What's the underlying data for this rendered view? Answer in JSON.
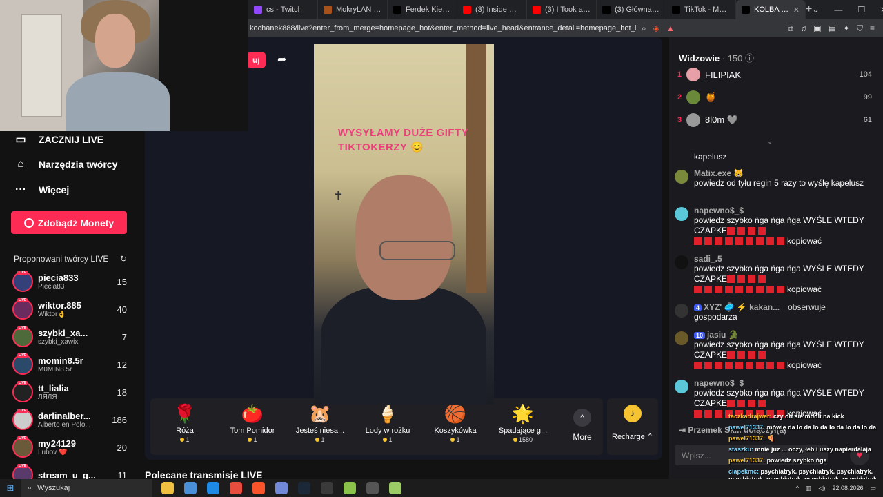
{
  "browser": {
    "tabs": [
      {
        "title": "cs - Twitch",
        "color": "#9146ff"
      },
      {
        "title": "MokryLAN - Turnie",
        "color": "#a8521b"
      },
      {
        "title": "Ferdek Kiepski Klu",
        "color": "#000000"
      },
      {
        "title": "(3) Inside Hong Ko",
        "color": "#ff0000"
      },
      {
        "title": "(3) I Took an Amaz",
        "color": "#ff0000"
      },
      {
        "title": "(3) Główna / X",
        "color": "#000000"
      },
      {
        "title": "TikTok - Make You",
        "color": "#000000"
      },
      {
        "title": "KOLBA (@k",
        "color": "#000000",
        "active": true
      }
    ],
    "url": "kochanek888/live?enter_from_merge=homepage_hot&enter_method=live_head&entrance_detail=homepage_hot_live_head&from_pl..."
  },
  "sidebar": {
    "links": [
      {
        "label": "ZACZNIJ LIVE",
        "icon": "video-camera-icon"
      },
      {
        "label": "Narzędzia twórcy",
        "icon": "creator-tools-icon"
      },
      {
        "label": "Więcej",
        "icon": "more-dots-icon"
      }
    ],
    "coins_button": "Zdobądź Monety",
    "suggested_title": "Proponowani twórcy LIVE",
    "creators": [
      {
        "user": "piecia833",
        "display": "Piecia83",
        "count": "15",
        "color": "#34407a"
      },
      {
        "user": "wiktor.885",
        "display": "Wiktor👌",
        "count": "40",
        "color": "#6a2b5e"
      },
      {
        "user": "szybki_xa...",
        "display": "szybki_xawix",
        "count": "7",
        "color": "#4e6a3a"
      },
      {
        "user": "momin8.5r",
        "display": "M0MIN8.5r",
        "count": "12",
        "color": "#2b4a6a"
      },
      {
        "user": "tt_lialia",
        "display": "ЛЯЛЯ",
        "count": "18",
        "color": "#222222"
      },
      {
        "user": "darlinalber...",
        "display": "Alberto en Polo...",
        "count": "186",
        "color": "#cccccc"
      },
      {
        "user": "my24129",
        "display": "Lubov ❤️",
        "count": "20",
        "color": "#6a5a3a"
      },
      {
        "user": "stream_u_g...",
        "display": "",
        "count": "11",
        "color": "#5a3a6a"
      }
    ]
  },
  "live": {
    "follow_label": "uj",
    "overlay_line1": "WYSYŁAMY DUŻE GIFTY",
    "overlay_line2": "TIKTOKERZY 😊",
    "gifts": [
      {
        "name": "Róża",
        "icon": "🌹",
        "price": "1"
      },
      {
        "name": "Tom Pomidor",
        "icon": "🍅",
        "price": "1"
      },
      {
        "name": "Jesteś niesa...",
        "icon": "🐹",
        "price": "1"
      },
      {
        "name": "Lody w rożku",
        "icon": "🍦",
        "price": "1"
      },
      {
        "name": "Koszykówka",
        "icon": "🏀",
        "price": "1"
      },
      {
        "name": "Spadające g...",
        "icon": "🌟",
        "price": "1580"
      }
    ],
    "more_label": "More",
    "recharge_label": "Recharge ⌃",
    "recommended_title": "Polecane transmisje LIVE"
  },
  "viewers": {
    "title": "Widzowie",
    "count": "150",
    "top": [
      {
        "rank": "1",
        "name": "FILIPIAK",
        "value": "104",
        "color": "#e8a0a8"
      },
      {
        "rank": "2",
        "name": "🍯",
        "value": "99",
        "color": "#6a8a3a"
      },
      {
        "rank": "3",
        "name": "8l0m 🩶",
        "value": "61",
        "color": "#999999"
      }
    ]
  },
  "chat": {
    "messages": [
      {
        "user": "",
        "text": "kapelusz"
      },
      {
        "user": "Matix.exe 😸",
        "text": "powiedz od tyłu regin 5 razy to wyślę kapelusz"
      },
      {
        "user": "napewno$_$",
        "text": "powiedz szybko ńga ńga ńga WYŚLE WTEDY CZAPKE",
        "tail": "kopiować"
      },
      {
        "user": "sadi_.5",
        "text": "powiedz szybko ńga ńga ńga WYŚLE WTEDY CZAPKE",
        "tail": "kopiować"
      },
      {
        "user": "XYZ' 🥏 ⚡ kakan...",
        "level": "4",
        "text": "gospodarza",
        "action": "obserwuje"
      },
      {
        "user": "jasiu 🐊",
        "level": "10",
        "text": "powiedz szybko ńga ńga ńga WYŚLE WTEDY CZAPKE",
        "tail": "kopiować"
      },
      {
        "user": "napewno$_$",
        "text": "powiedz szybko ńga ńga ńga WYŚLE WTEDY CZAPKE",
        "tail": "kopiować"
      }
    ],
    "join_text": "Przemek Sk... dołączył(a)",
    "input_placeholder": "Wpisz..."
  },
  "twitch_overlay": [
    {
      "name": "taczkadrajwer:",
      "text": "czy on sie modli na kick"
    },
    {
      "name": "pawel71337:",
      "text": "mówię da lo da lo da lo da lo da lo da"
    },
    {
      "name": "pawel71337:",
      "text": "🍕"
    },
    {
      "name": "staszku:",
      "text": "mnie juz ... oczy, łeb i uszy napierdalaja"
    },
    {
      "name": "pawel71337:",
      "text": "powiedz szybko ńga"
    },
    {
      "name": "ciapekmc:",
      "text": "psychiatryk. psychiatryk. psychiatryk. psychiatryk. psychiatryk. psychiatryk. psychiatryk. psychiatryk."
    }
  ],
  "taskbar": {
    "search_label": "Wyszukaj",
    "time": "22.08.2026",
    "apps": [
      "#f0c040",
      "#4a90d9",
      "#1e8ae6",
      "#e84d3d",
      "#fb542b",
      "#7289da",
      "#1b2838",
      "#3a3a3a",
      "#8bc34a",
      "#555555",
      "#9ccc65"
    ]
  }
}
